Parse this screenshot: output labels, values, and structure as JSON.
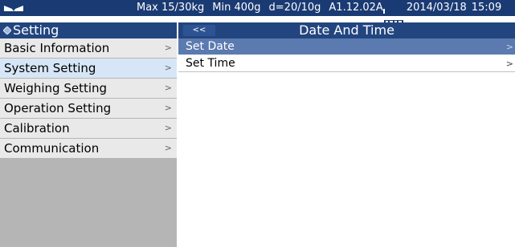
{
  "status_bar": {
    "signal_icon": "signal-icon",
    "max": "Max 15/30kg",
    "min": "Min 400g",
    "division": "d=20/10g",
    "version": "A1.12.02A",
    "battery_icon": "battery-icon",
    "date": "2014/03/18",
    "time": "15:09"
  },
  "sidebar": {
    "header": {
      "icon": "diamond-icon",
      "title": "Setting"
    },
    "items": [
      {
        "label": "Basic Information",
        "chevron": ">"
      },
      {
        "label": "System Setting",
        "chevron": ">",
        "selected": true
      },
      {
        "label": "Weighing Setting",
        "chevron": ">"
      },
      {
        "label": "Operation Setting",
        "chevron": ">"
      },
      {
        "label": "Calibration",
        "chevron": ">"
      },
      {
        "label": "Communication",
        "chevron": ">"
      }
    ]
  },
  "main": {
    "back_label": "<<",
    "title": "Date And Time",
    "items": [
      {
        "label": "Set Date",
        "chevron": ">",
        "active": true
      },
      {
        "label": "Set Time",
        "chevron": ">"
      }
    ]
  },
  "colors": {
    "status_bar_bg": "#1a3a73",
    "header_bg": "#23457f",
    "active_item_bg": "#5b7ab0",
    "selected_sidebar_bg": "#d6e6f7",
    "sidebar_item_bg": "#e9e9e9",
    "sidebar_bg": "#b5b5b5"
  }
}
